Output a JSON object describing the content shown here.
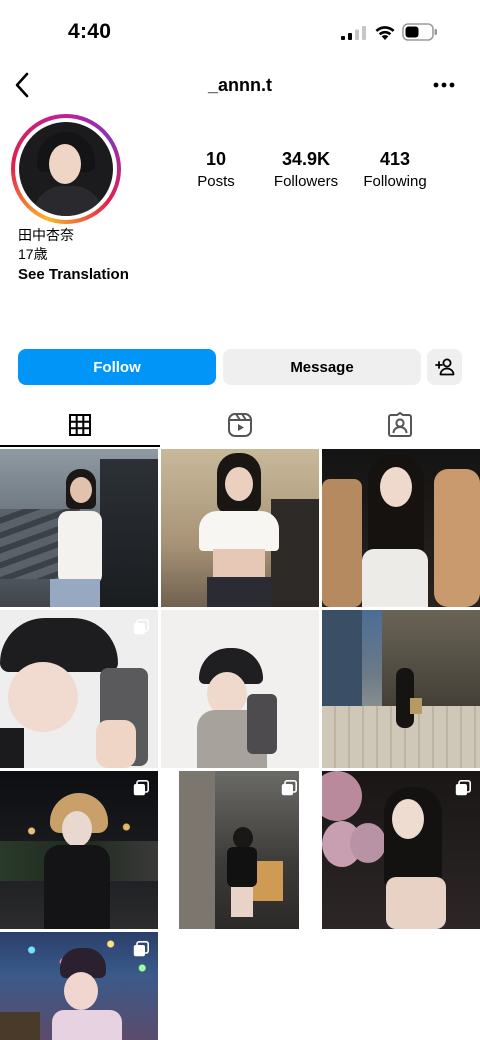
{
  "status_bar": {
    "time": "4:40"
  },
  "header": {
    "username": "_annn.t"
  },
  "profile": {
    "stats": [
      {
        "value": "10",
        "label": "Posts"
      },
      {
        "value": "34.9K",
        "label": "Followers"
      },
      {
        "value": "413",
        "label": "Following"
      }
    ],
    "bio": {
      "name": "田中杏奈",
      "age": "17歳",
      "translate": "See Translation"
    }
  },
  "actions": {
    "follow": "Follow",
    "message": "Message"
  },
  "tabs": [
    {
      "icon": "grid-icon",
      "active": true
    },
    {
      "icon": "reels-icon",
      "active": false
    },
    {
      "icon": "tagged-icon",
      "active": false
    }
  ],
  "posts": [
    {
      "id": 1,
      "theme": "city-stairs",
      "multi": false
    },
    {
      "id": 2,
      "theme": "indoor-white-top",
      "multi": false
    },
    {
      "id": 3,
      "theme": "car-night",
      "multi": false
    },
    {
      "id": 4,
      "theme": "cap-selfie",
      "multi": true
    },
    {
      "id": 5,
      "theme": "cap-mirror",
      "multi": false
    },
    {
      "id": 6,
      "theme": "street-evening",
      "multi": false
    },
    {
      "id": 7,
      "theme": "park-night",
      "multi": true
    },
    {
      "id": 8,
      "theme": "building-night",
      "multi": true
    },
    {
      "id": 9,
      "theme": "balloons",
      "multi": true
    },
    {
      "id": 10,
      "theme": "character-night",
      "multi": true
    }
  ]
}
